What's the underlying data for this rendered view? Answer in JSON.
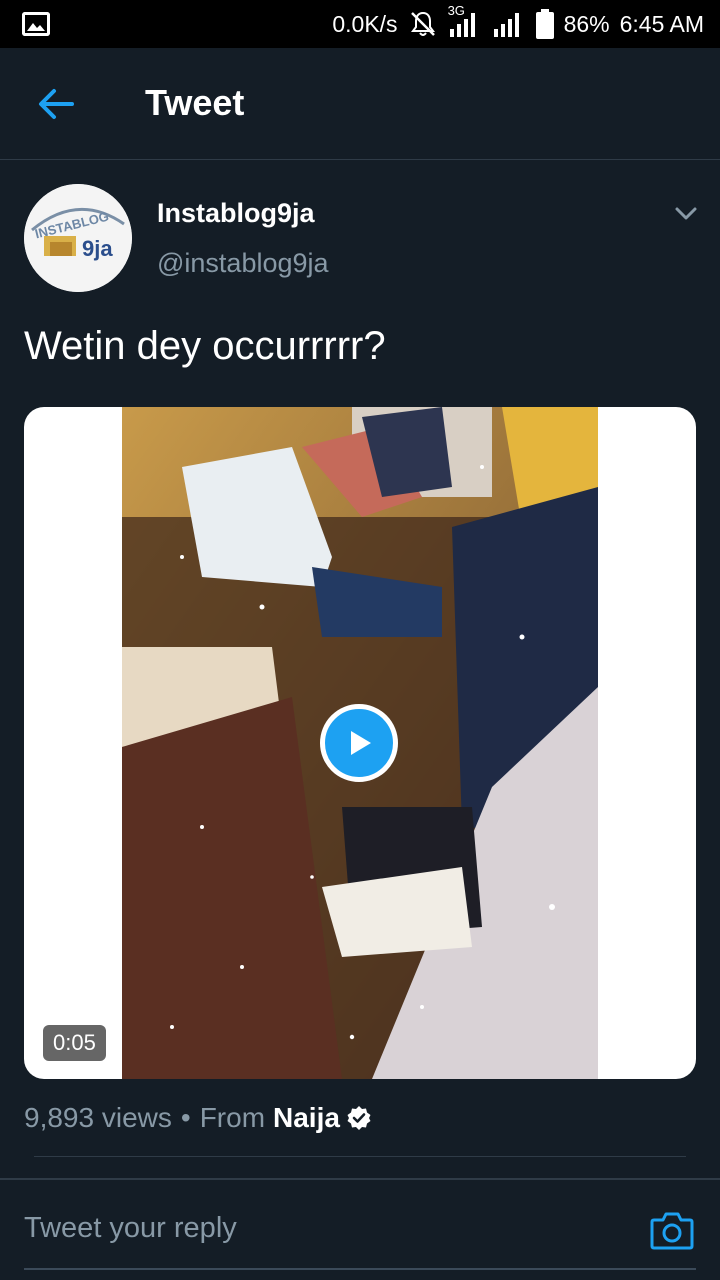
{
  "status_bar": {
    "net_speed": "0.0K/s",
    "network_type": "3G",
    "battery": "86%",
    "time": "6:45 AM"
  },
  "header": {
    "title": "Tweet"
  },
  "tweet": {
    "author_name": "Instablog9ja",
    "author_handle": "@instablog9ja",
    "text": "Wetin dey occurrrrr?",
    "avatar_text_top": "INSTABLOG",
    "avatar_text_bottom": "9ja"
  },
  "media": {
    "duration": "0:05"
  },
  "meta": {
    "views": "9,893 views",
    "separator": "•",
    "from_label": "From",
    "source": "Naija"
  },
  "reply": {
    "placeholder": "Tweet your reply"
  },
  "colors": {
    "background": "#141d26",
    "accent": "#1da1f2",
    "secondary_text": "#8899a6",
    "divider": "#2f3b47"
  }
}
